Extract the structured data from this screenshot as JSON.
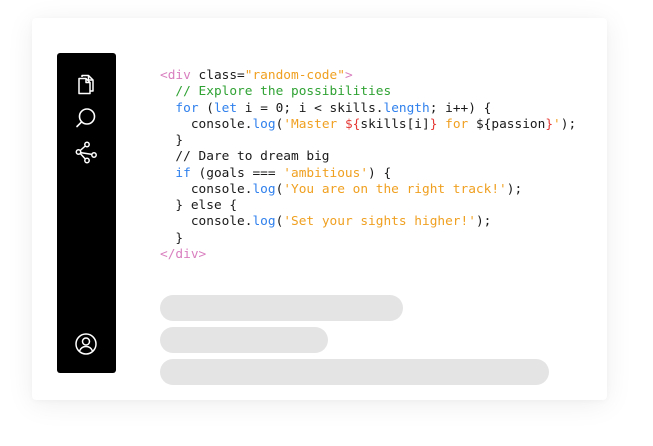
{
  "sidebar": {
    "icons": [
      "files-icon",
      "search-icon",
      "share-icon",
      "user-icon"
    ]
  },
  "code": {
    "l1": {
      "open": "<div ",
      "attr": "class=",
      "val": "\"random-code\"",
      "close": ">"
    },
    "l2": {
      "comment": "// Explore the possibilities"
    },
    "l3": {
      "for_kw": "for",
      "a": " (",
      "let_kw": "let",
      "b": " i = 0; i < skills.",
      "length": "length",
      "c": "; i++) {"
    },
    "l4": {
      "a": "console.",
      "log": "log",
      "b": "(",
      "s1": "'Master ",
      "i1": "${",
      "mid": "skills[i]",
      "i2": "}",
      "for_kw": " for ",
      "d": "${",
      "mid2": "passion",
      "i3": "}",
      "s2": "'",
      "c": ");"
    },
    "l5": {
      "text": "}"
    },
    "l6": {
      "text": "// Dare to dream big"
    },
    "l7": {
      "if_kw": "if",
      "a": " (goals === ",
      "str": "'ambitious'",
      "b": ") {"
    },
    "l8": {
      "a": "console.",
      "log": "log",
      "b": "(",
      "str": "'You are on the right track!'",
      "c": ");"
    },
    "l9": {
      "text": "} else {"
    },
    "l10": {
      "a": "console.",
      "log": "log",
      "b": "(",
      "str": "'Set your sights higher!'",
      "c": ");"
    },
    "l11": {
      "text": "}"
    },
    "l12": {
      "close": "</div>"
    }
  },
  "colors": {
    "tag": "#d97fbf",
    "string": "#f0a020",
    "comment": "#2fa233",
    "keyword": "#2f80ed",
    "interpolation": "#e53935",
    "placeholder": "#e4e4e4",
    "sidebar": "#000000"
  }
}
